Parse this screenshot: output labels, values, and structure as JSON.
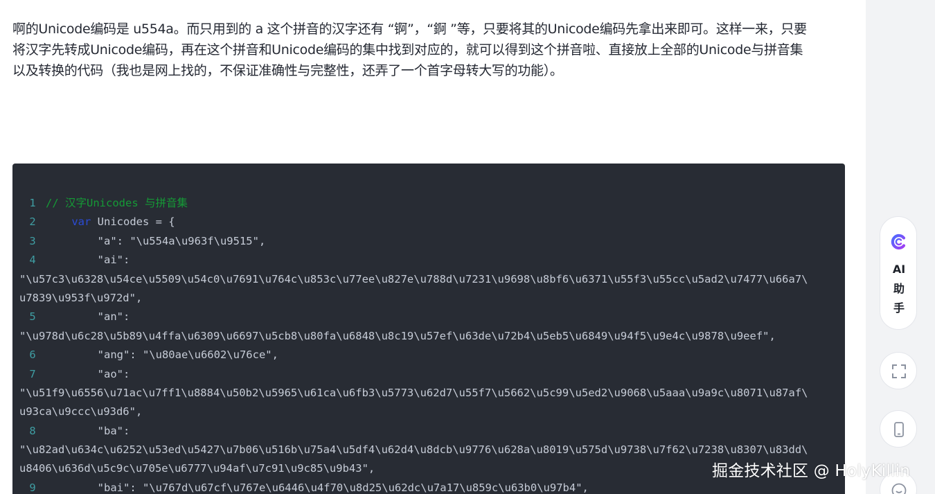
{
  "article": {
    "paragraph_lines": [
      "啊的Unicode编码是 u554a。而只用到的 a 这个拼音的汉字还有 “锕”，“錒 ”等，只要将其的Unicode编码先拿出来即可。这样一来，只要",
      "将汉字先转成Unicode编码，再在这个拼音和Unicode编码的集中找到对应的，就可以得到这个拼音啦、直接放上全部的Unicode与拼音集",
      "以及转换的代码（我也是网上找的，不保证准确性与完整性，还弄了一个首字母转大写的功能）。"
    ]
  },
  "code": {
    "lines": [
      {
        "n": "1",
        "tokens": [
          {
            "t": "// 汉字Unicodes 与拼音集",
            "c": "comment"
          }
        ]
      },
      {
        "n": "2",
        "tokens": [
          {
            "t": "    ",
            "c": "plain"
          },
          {
            "t": "var",
            "c": "keyword"
          },
          {
            "t": " Unicodes = {",
            "c": "plain"
          }
        ]
      },
      {
        "n": "3",
        "tokens": [
          {
            "t": "        \"a\": \"\\u554a\\u963f\\u9515\",",
            "c": "plain"
          }
        ]
      },
      {
        "n": "4",
        "tokens": [
          {
            "t": "        \"ai\":",
            "c": "plain"
          }
        ]
      },
      {
        "n": "",
        "tokens": [
          {
            "t": "\"\\u57c3\\u6328\\u54ce\\u5509\\u54c0\\u7691\\u764c\\u853c\\u77ee\\u827e\\u788d\\u7231\\u9698\\u8bf6\\u6371\\u55f3\\u55cc\\u5ad2\\u7477\\u66a7\\",
            "c": "plain"
          }
        ]
      },
      {
        "n": "",
        "tokens": [
          {
            "t": "u7839\\u953f\\u972d\",",
            "c": "plain"
          }
        ]
      },
      {
        "n": "5",
        "tokens": [
          {
            "t": "        \"an\":",
            "c": "plain"
          }
        ]
      },
      {
        "n": "",
        "tokens": [
          {
            "t": "\"\\u978d\\u6c28\\u5b89\\u4ffa\\u6309\\u6697\\u5cb8\\u80fa\\u6848\\u8c19\\u57ef\\u63de\\u72b4\\u5eb5\\u6849\\u94f5\\u9e4c\\u9878\\u9eef\",",
            "c": "plain"
          }
        ]
      },
      {
        "n": "6",
        "tokens": [
          {
            "t": "        \"ang\": \"\\u80ae\\u6602\\u76ce\",",
            "c": "plain"
          }
        ]
      },
      {
        "n": "7",
        "tokens": [
          {
            "t": "        \"ao\":",
            "c": "plain"
          }
        ]
      },
      {
        "n": "",
        "tokens": [
          {
            "t": "\"\\u51f9\\u6556\\u71ac\\u7ff1\\u8884\\u50b2\\u5965\\u61ca\\u6fb3\\u5773\\u62d7\\u55f7\\u5662\\u5c99\\u5ed2\\u9068\\u5aaa\\u9a9c\\u8071\\u87af\\",
            "c": "plain"
          }
        ]
      },
      {
        "n": "",
        "tokens": [
          {
            "t": "u93ca\\u9ccc\\u93d6\",",
            "c": "plain"
          }
        ]
      },
      {
        "n": "8",
        "tokens": [
          {
            "t": "        \"ba\":",
            "c": "plain"
          }
        ]
      },
      {
        "n": "",
        "tokens": [
          {
            "t": "\"\\u82ad\\u634c\\u6252\\u53ed\\u5427\\u7b06\\u516b\\u75a4\\u5df4\\u62d4\\u8dcb\\u9776\\u628a\\u8019\\u575d\\u9738\\u7f62\\u7238\\u8307\\u83dd\\",
            "c": "plain"
          }
        ]
      },
      {
        "n": "",
        "tokens": [
          {
            "t": "u8406\\u636d\\u5c9c\\u705e\\u6777\\u94af\\u7c91\\u9c85\\u9b43\",",
            "c": "plain"
          }
        ]
      },
      {
        "n": "9",
        "tokens": [
          {
            "t": "        \"bai\": \"\\u767d\\u67cf\\u767e\\u6446\\u4f70\\u8d25\\u62dc\\u7a17\\u859c\\u63b0\\u97b4\",",
            "c": "plain"
          }
        ]
      }
    ]
  },
  "side_tools": {
    "ai_label": "AI\n助\n手",
    "ai_icon": "juejin-ai-logo-icon",
    "fullscreen_icon": "fullscreen-icon",
    "mobile_icon": "mobile-phone-icon",
    "smile_icon": "smile-icon",
    "brand_color": "#6b4cf6"
  },
  "watermark": "掘金技术社区 @ HolyKillin"
}
